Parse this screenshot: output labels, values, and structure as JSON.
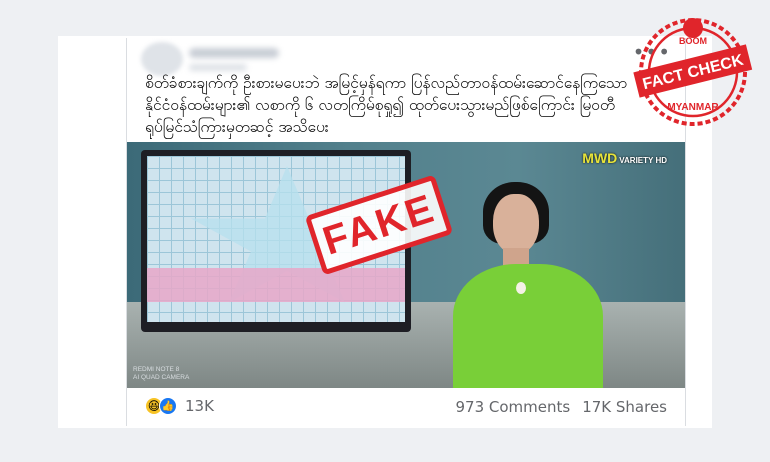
{
  "post": {
    "text": "စိတ်ခံစားချက်ကို ဦးစားမပေးဘဲ အမြင့်မှန်ရကာ ပြန်လည်တာဝန်ထမ်းဆောင်နေကြသော နိုင်ငံ၀န်ထမ်းများ၏ လစာကို ၆ လတကြိမ်စုရှု၍ ထုတ်ပေးသွားမည်ဖြစ်ကြောင်း မြဝတီရုပ်မြင်သံကြားမှတဆင့် အသိပေး",
    "more_label": "•••"
  },
  "video": {
    "channel_logo": "MWD",
    "channel_sub": "VARIETY HD",
    "watermark_line1": "REDMI NOTE 8",
    "watermark_line2": "AI QUAD CAMERA",
    "stamp_text": "FAKE"
  },
  "footer": {
    "reaction_count": "13K",
    "comments": "973 Comments",
    "shares": "17K Shares",
    "reactions": [
      "haha-icon",
      "like-icon"
    ]
  },
  "badge": {
    "top": "BOOM",
    "main": "FACT CHECK",
    "bottom": "MYANMAR",
    "color": "#e0252b"
  }
}
